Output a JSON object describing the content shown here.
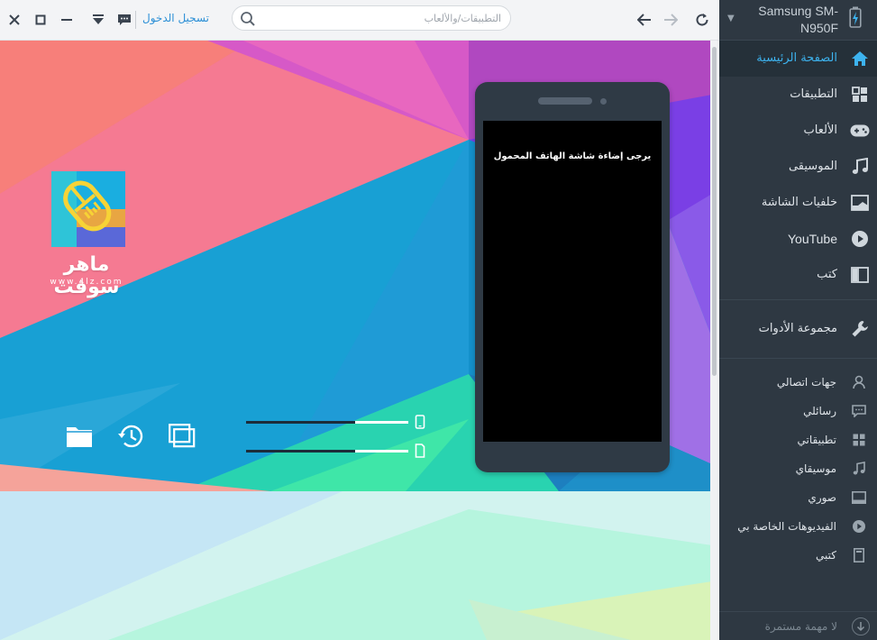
{
  "topbar": {
    "login_label": "تسجيل الدخول",
    "search_placeholder": "التطبيقات/والألعاب"
  },
  "hero": {
    "logo_name": "ماهر سوفت",
    "logo_url": "www.4lz.com",
    "phone_message": "يرجى إضاءة شاشة الهاتف المحمول",
    "storage": [
      {
        "name": "phone-storage",
        "fill": 0.67
      },
      {
        "name": "sd-storage",
        "fill": 0.67
      }
    ]
  },
  "sidebar": {
    "device": "Samsung SM-N950F",
    "nav": [
      {
        "label": "الصفحة الرئيسية",
        "icon": "home-icon",
        "active": true
      },
      {
        "label": "التطبيقات",
        "icon": "apps-icon"
      },
      {
        "label": "الألعاب",
        "icon": "gamepad-icon"
      },
      {
        "label": "الموسيقى",
        "icon": "music-icon"
      },
      {
        "label": "خلفيات الشاشة",
        "icon": "wallpaper-icon"
      },
      {
        "label": "YouTube",
        "icon": "youtube-icon"
      },
      {
        "label": "كتب",
        "icon": "book-icon"
      }
    ],
    "toolbox": {
      "label": "مجموعة الأدوات",
      "icon": "wrench-icon"
    },
    "library": [
      {
        "label": "جهات اتصالي",
        "icon": "contact-icon"
      },
      {
        "label": "رسائلي",
        "icon": "message-icon"
      },
      {
        "label": "تطبيقاتي",
        "icon": "apps-icon"
      },
      {
        "label": "موسيقاي",
        "icon": "music-icon"
      },
      {
        "label": "صوري",
        "icon": "photo-icon"
      },
      {
        "label": "الفيديوهات الخاصة بي",
        "icon": "video-icon"
      },
      {
        "label": "كتبي",
        "icon": "book-icon"
      }
    ],
    "task_label": "لا مهمة مستمرة"
  },
  "colors": {
    "accent": "#3db3ef",
    "sidebar_bg": "#2e3842",
    "link": "#2b8fd6"
  }
}
